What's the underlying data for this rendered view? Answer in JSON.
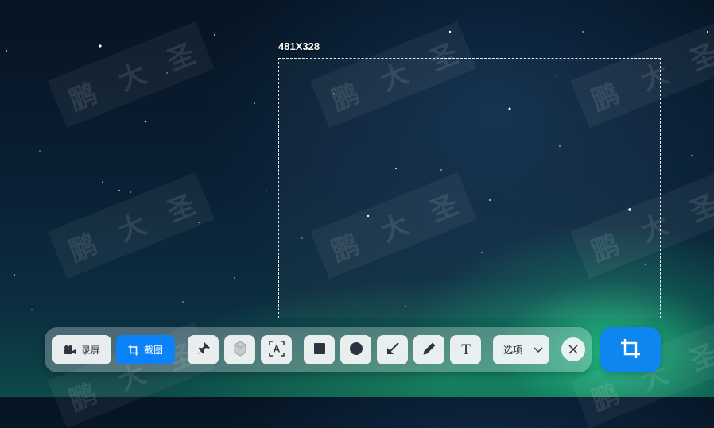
{
  "selection": {
    "size_label": "481X328"
  },
  "watermark": {
    "chars": [
      "鹏",
      "大",
      "圣"
    ]
  },
  "toolbar": {
    "record_label": "录屏",
    "screenshot_label": "截图",
    "options_label": "选项",
    "tools": [
      "pin-icon",
      "blur-icon",
      "ocr-icon",
      "rectangle-icon",
      "ellipse-icon",
      "arrow-icon",
      "pen-icon",
      "text-icon"
    ]
  },
  "colors": {
    "accent": "#0c82f8",
    "confirm": "#0d86f0",
    "toolbar_button": "#f6f7f9"
  }
}
